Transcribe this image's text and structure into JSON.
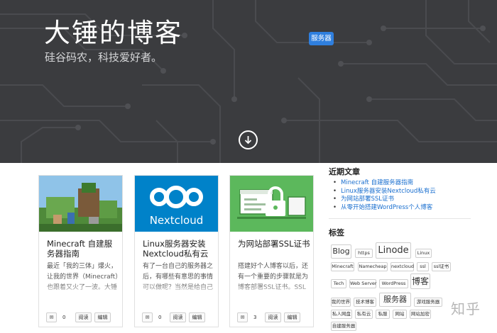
{
  "hero": {
    "title": "大锤的博客",
    "subtitle": "硅谷码农，科技爱好者。",
    "badge": "服务器"
  },
  "posts": [
    {
      "title": "Minecraft 自建服务器指南",
      "excerpt": "最近「我的三体」爆火，让我的世界（Minecraft）也跟着又火了一波。大锤平时玩游戏不多，但是",
      "comments": "0",
      "read_label": "阅读",
      "edit_label": "编辑"
    },
    {
      "title": "Linux服务器安装Nextcloud私有云",
      "excerpt": "有了一台自己的服务器之后，有哪些有意思的事情可以做呢？当然是给自己建一个私有云了！私有云",
      "comments": "0",
      "read_label": "阅读",
      "edit_label": "编辑",
      "logo_text": "Nextcloud"
    },
    {
      "title": "为网站部署SSL证书",
      "excerpt": "搭建好个人博客以后，还有一个重要的步骤就是为博客部署SSL证书。SSL证书大家可能没听说过，但是你一定听说过",
      "comments": "3",
      "read_label": "阅读",
      "edit_label": "编辑"
    }
  ],
  "sidebar": {
    "recent_heading": "近期文章",
    "recent": [
      "Minecraft 自建服务器指南",
      "Linux服务器安装Nextcloud私有云",
      "为网站部署SSL证书",
      "从零开始搭建WordPress个人博客"
    ],
    "tags_heading": "标签",
    "tags": [
      "Blog",
      "https",
      "Linode",
      "Linux",
      "Minecraft",
      "Namecheap",
      "nextcloud",
      "ssl",
      "ssl证书",
      "Tech",
      "Web Server",
      "WordPress",
      "博客",
      "我的世界",
      "技术博客",
      "服务器",
      "游戏服务器",
      "私人网盘",
      "私有云",
      "私服",
      "网站",
      "网站加密",
      "自建服务器"
    ]
  },
  "watermark": "知乎",
  "colors": {
    "hero_bg": "#3b3c3f",
    "accent": "#2f7fde",
    "link": "#1a6fcf",
    "nextcloud_blue": "#0082c9",
    "ssl_green": "#5cb85c"
  }
}
